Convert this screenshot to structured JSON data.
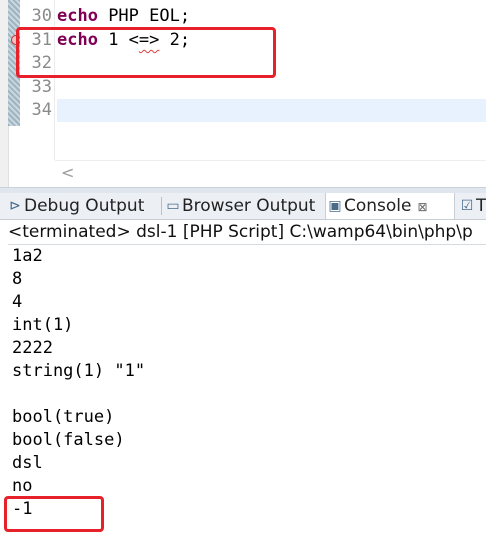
{
  "editor": {
    "line_numbers": [
      "30",
      "31",
      "32",
      "33",
      "34"
    ],
    "lines": [
      {
        "keyword": "echo",
        "rest": " PHP EOL;",
        "squiggle": ""
      },
      {
        "keyword": "echo",
        "rest": " 1 <",
        "squiggle": "=>",
        "tail": " 2;"
      },
      {
        "keyword": "",
        "rest": "",
        "squiggle": ""
      },
      {
        "keyword": "",
        "rest": "",
        "squiggle": ""
      },
      {
        "keyword": "",
        "rest": "",
        "squiggle": ""
      }
    ],
    "scroll_left_glyph": "<"
  },
  "tabs": [
    {
      "label": "Debug Output",
      "icon": "debug-output-icon"
    },
    {
      "label": "Browser Output",
      "icon": "browser-output-icon"
    },
    {
      "label": "Console",
      "icon": "console-icon",
      "close": "⊠",
      "active": true
    },
    {
      "label": "T",
      "icon": "tasks-icon"
    }
  ],
  "console": {
    "header": "<terminated> dsl-1 [PHP Script] C:\\wamp64\\bin\\php\\p",
    "output": [
      "1a2",
      "8",
      "4",
      "int(1)",
      "2222",
      "string(1) \"1\"",
      "",
      "bool(true)",
      "bool(false)",
      "dsl",
      "no",
      "-1"
    ]
  },
  "colors": {
    "keyword": "#7f0055",
    "highlight_box": "#e8202a",
    "current_line": "#e8f2fe"
  }
}
